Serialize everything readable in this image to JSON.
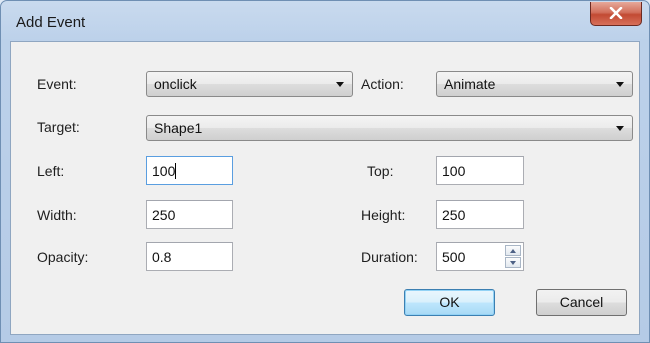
{
  "window": {
    "title": "Add Event",
    "close_icon": "close-icon"
  },
  "form": {
    "event": {
      "label": "Event:",
      "value": "onclick"
    },
    "action": {
      "label": "Action:",
      "value": "Animate"
    },
    "target": {
      "label": "Target:",
      "value": "Shape1"
    },
    "left": {
      "label": "Left:",
      "value": "100"
    },
    "top": {
      "label": "Top:",
      "value": "100"
    },
    "width": {
      "label": "Width:",
      "value": "250"
    },
    "height": {
      "label": "Height:",
      "value": "250"
    },
    "opacity": {
      "label": "Opacity:",
      "value": "0.8"
    },
    "duration": {
      "label": "Duration:",
      "value": "500"
    }
  },
  "buttons": {
    "ok": "OK",
    "cancel": "Cancel"
  },
  "colors": {
    "frame": "#bcd1ea",
    "client": "#f0f0f0",
    "close_button": "#c24a33",
    "default_button": "#bee6fd"
  }
}
